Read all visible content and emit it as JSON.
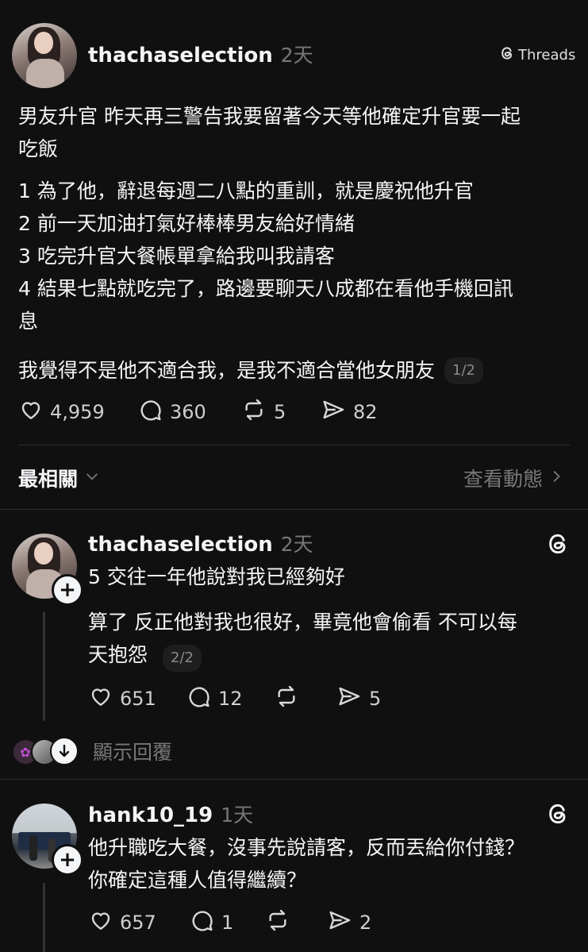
{
  "post": {
    "username": "thachaselection",
    "time": "2天",
    "brand": "Threads",
    "lines": [
      "男友升官 昨天再三警告我要留著今天等他確定升官要一起\n吃飯",
      "1 為了他，辭退每週二八點的重訓，就是慶祝他升官\n2 前一天加油打氣好棒棒男友給好情緒\n3 吃完升官大餐帳單拿給我叫我請客\n4 結果七點就吃完了，路邊要聊天八成都在看他手機回訊\n息",
      "我覺得不是他不適合我，是我不適合當他女朋友"
    ],
    "page": "1/2",
    "likes": "4,959",
    "comments": "360",
    "reposts": "5",
    "shares": "82"
  },
  "sort": {
    "label": "最相關",
    "view_activity": "查看動態"
  },
  "reply1": {
    "username": "thachaselection",
    "time": "2天",
    "line1": "5 交往一年他說對我已經夠好",
    "line2": "算了 反正他對我也很好，畢竟他會偷看 不可以每\n天抱怨",
    "page": "2/2",
    "likes": "651",
    "comments": "12",
    "shares": "5",
    "show_replies": "顯示回覆"
  },
  "reply2": {
    "username": "hank10_19",
    "time": "1天",
    "text": "他升職吃大餐，沒事先說請客，反而丟給你付錢？\n你確定這種人值得繼續？",
    "likes": "657",
    "comments": "1",
    "shares": "2"
  },
  "icons": {
    "like": "heart-icon",
    "comment": "comment-icon",
    "repost": "repost-icon",
    "share": "share-icon",
    "threads": "threads-logo-icon"
  }
}
